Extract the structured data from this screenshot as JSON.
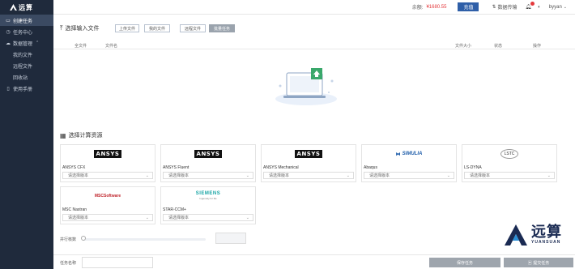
{
  "app": {
    "name": "远算"
  },
  "sidebar": {
    "items": [
      {
        "label": "创建任务",
        "icon": "new-task-icon"
      },
      {
        "label": "任务中心",
        "icon": "clock-icon"
      },
      {
        "label": "数据管理",
        "icon": "cloud-icon"
      },
      {
        "label": "我的文件"
      },
      {
        "label": "远程文件"
      },
      {
        "label": "回收站"
      },
      {
        "label": "使用手册",
        "icon": "book-icon"
      }
    ]
  },
  "header": {
    "balance_label": "余额:",
    "balance_value": "¥1680.55",
    "recharge_label": "充值",
    "data_transfer_label": "数据传输",
    "username": "byyan"
  },
  "upload": {
    "title": "选择输入文件",
    "buttons": [
      "上传文件",
      "我的文件",
      "远程文件",
      "批量任务"
    ],
    "columns": [
      "全文件",
      "文件名",
      "文件大小",
      "状态",
      "操作"
    ]
  },
  "resources": {
    "title": "选择计算资源",
    "select_placeholder": "请选择版本",
    "items": [
      {
        "name": "ANSYS CFX",
        "logo_text": "ANSYS",
        "logo_style": "ansys"
      },
      {
        "name": "ANSYS Fluent",
        "logo_text": "ANSYS",
        "logo_style": "ansys"
      },
      {
        "name": "ANSYS Mechanical",
        "logo_text": "ANSYS",
        "logo_style": "ansys"
      },
      {
        "name": "Abaqus",
        "logo_text": "SIMULIA",
        "logo_style": "simulia"
      },
      {
        "name": "LS-DYNA",
        "logo_text": "LSTC",
        "logo_style": "lstc"
      },
      {
        "name": "MSC Nastran",
        "logo_text": "MSCSoftware",
        "logo_style": "msc"
      },
      {
        "name": "STAR-CCM+",
        "logo_text": "SIEMENS",
        "logo_style": "siemens"
      }
    ]
  },
  "parallel": {
    "label": "并行核数"
  },
  "footer": {
    "task_name_label": "任务名称",
    "save_label": "保存任务",
    "submit_label": "提交任务"
  },
  "watermark": {
    "title": "远算",
    "subtitle": "YUANSUAN"
  },
  "colors": {
    "sidebar_bg": "#1f2a3c",
    "accent": "#2f5fa8",
    "balance": "#e4393c"
  }
}
